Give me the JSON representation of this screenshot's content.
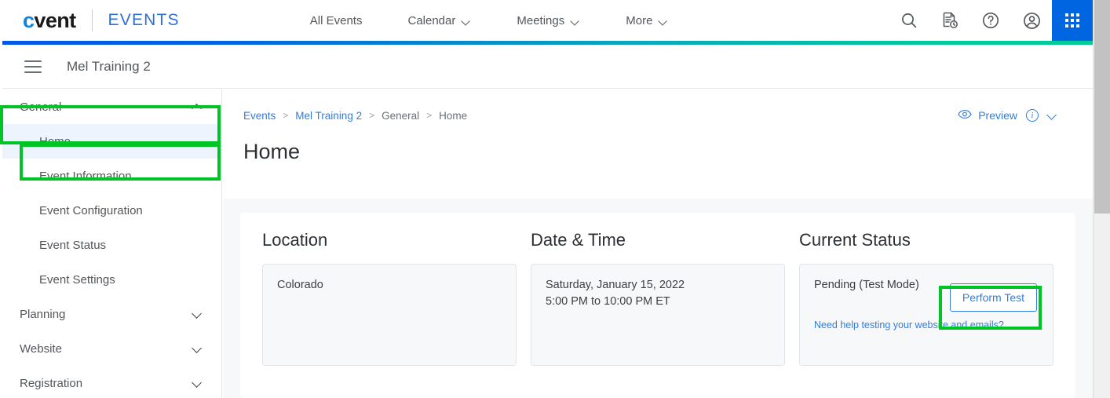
{
  "topbar": {
    "logo_c": "c",
    "logo_rest": "vent",
    "product": "EVENTS",
    "nav": [
      {
        "label": "All Events",
        "has_chevron": false
      },
      {
        "label": "Calendar",
        "has_chevron": true
      },
      {
        "label": "Meetings",
        "has_chevron": true
      },
      {
        "label": "More",
        "has_chevron": true
      }
    ],
    "icons": [
      {
        "name": "search-icon"
      },
      {
        "name": "report-clock-icon"
      },
      {
        "name": "help-circle-icon"
      },
      {
        "name": "user-account-icon"
      },
      {
        "name": "app-grid-icon"
      }
    ],
    "accent_start_color": "#0058e8",
    "accent_end_color": "#00cc9a",
    "appgrid_color": "#0065e0"
  },
  "eventbar": {
    "menu_icon": "hamburger-icon",
    "title": "Mel Training 2"
  },
  "sidebar": {
    "groups": [
      {
        "label": "General",
        "expanded": true,
        "items": [
          {
            "label": "Home",
            "active": true
          },
          {
            "label": "Event Information",
            "active": false
          },
          {
            "label": "Event Configuration",
            "active": false
          },
          {
            "label": "Event Status",
            "active": false
          },
          {
            "label": "Event Settings",
            "active": false
          }
        ]
      },
      {
        "label": "Planning",
        "expanded": false,
        "items": []
      },
      {
        "label": "Website",
        "expanded": false,
        "items": []
      },
      {
        "label": "Registration",
        "expanded": false,
        "items": []
      }
    ],
    "active_bg": "#eef4fd"
  },
  "breadcrumb": {
    "items": [
      {
        "label": "Events",
        "link": true
      },
      {
        "label": "Mel Training 2",
        "link": true
      },
      {
        "label": "General",
        "link": false
      },
      {
        "label": "Home",
        "link": false
      }
    ],
    "separator": ">"
  },
  "preview": {
    "eye_icon": "eye-icon",
    "label": "Preview",
    "info_icon": "info-circle-icon",
    "info_glyph": "i",
    "chevron_icon": "chevron-down-icon"
  },
  "page": {
    "title": "Home"
  },
  "cards": [
    {
      "id": "location",
      "title": "Location",
      "lines": [
        "Colorado"
      ]
    },
    {
      "id": "date-time",
      "title": "Date & Time",
      "lines": [
        "Saturday, January 15, 2022",
        "5:00 PM to 10:00 PM ET"
      ]
    },
    {
      "id": "current-status",
      "title": "Current Status",
      "status_text": "Pending (Test Mode)",
      "button_label": "Perform Test",
      "help_link": "Need help testing your website and emails?"
    }
  ],
  "highlights": {
    "color": "#00c425",
    "targets": [
      "General",
      "Home",
      "Perform Test"
    ]
  },
  "scrollbar": {
    "track_color": "#f0f0f0",
    "thumb_color": "#c2c2c2"
  }
}
